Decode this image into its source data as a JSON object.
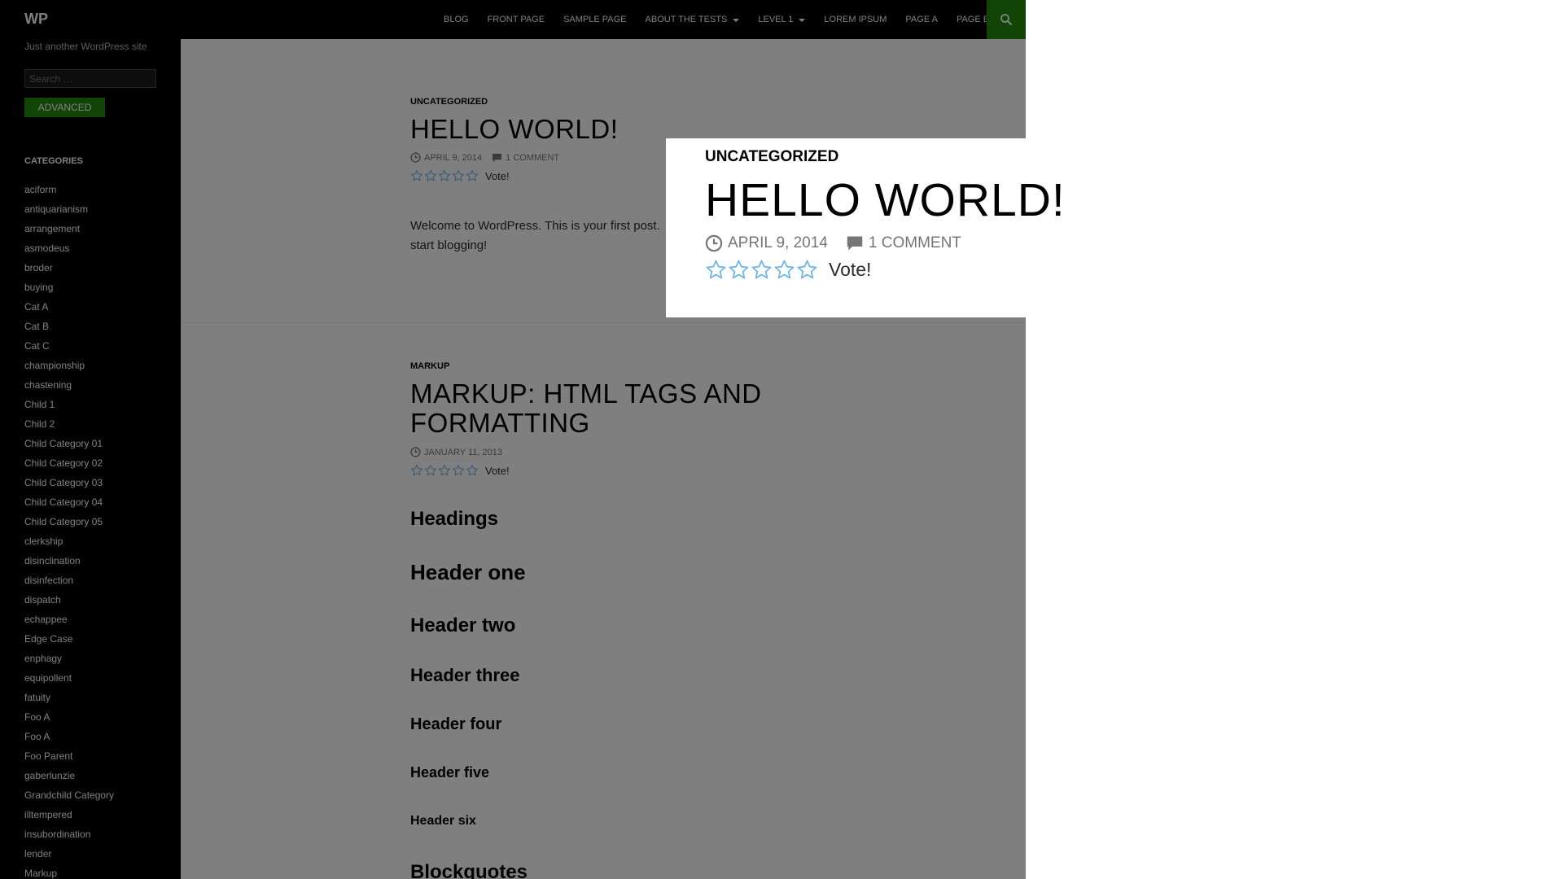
{
  "header": {
    "site_title": "WP",
    "nav": [
      "Blog",
      "Front Page",
      "Sample Page",
      "About The Tests",
      "Level 1",
      "Lorem Ipsum",
      "Page A",
      "Page B"
    ],
    "search_icon": "search-icon",
    "accent_color": "#24890d"
  },
  "sidebar": {
    "tagline": "Just another WordPress site",
    "search_placeholder": "Search …",
    "advanced_label": "Advanced",
    "categories_title": "Categories",
    "categories": [
      "aciform",
      "antiquarianism",
      "arrangement",
      "asmodeus",
      "broder",
      "buying",
      "Cat A",
      "Cat B",
      "Cat C",
      "championship",
      "chastening",
      "Child 1",
      "Child 2",
      "Child Category 01",
      "Child Category 02",
      "Child Category 03",
      "Child Category 04",
      "Child Category 05",
      "clerkship",
      "disinclination",
      "disinfection",
      "dispatch",
      "echappee",
      "Edge Case",
      "enphagy",
      "equipollent",
      "fatuity",
      "Foo A",
      "Foo A",
      "Foo Parent",
      "gaberlunzie",
      "Grandchild Category",
      "illtempered",
      "insubordination",
      "lender",
      "Markup"
    ]
  },
  "posts": [
    {
      "category": "Uncategorized",
      "title": "Hello world!",
      "date": "April 9, 2014",
      "comments": "1 Comment",
      "vote": "Vote!",
      "excerpt_line1": "Welcome to WordPress. This is your first post.",
      "excerpt_line2": "start blogging!"
    },
    {
      "category": "Markup",
      "title_line1": "Markup: HTML Tags and",
      "title_line2": "Formatting",
      "date": "January 11, 2013",
      "vote": "Vote!",
      "headings": [
        "Headings",
        "Header one",
        "Header two",
        "Header three",
        "Header four",
        "Header five",
        "Header six",
        "Blockquotes"
      ]
    }
  ]
}
